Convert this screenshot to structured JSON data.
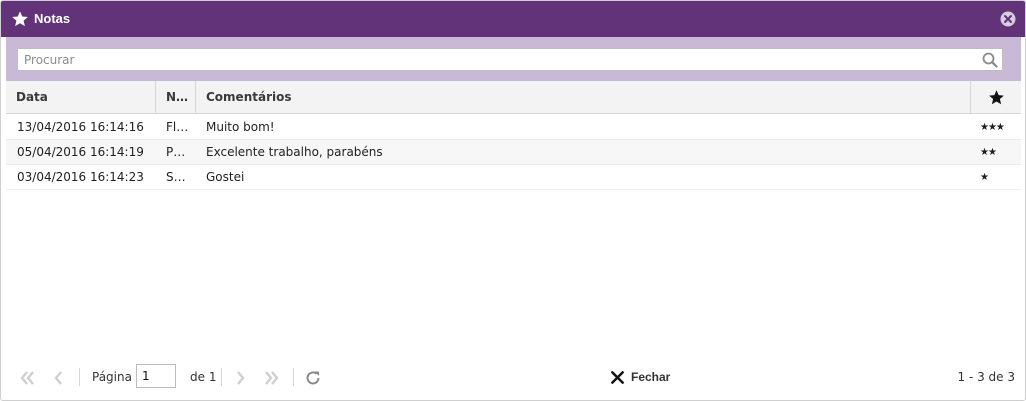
{
  "window": {
    "title": "Notas"
  },
  "search": {
    "placeholder": "Procurar"
  },
  "table": {
    "columns": [
      "Data",
      "N…",
      "Comentários"
    ],
    "rows": [
      {
        "date": "13/04/2016 16:14:16",
        "name": "Fl…",
        "comment": "Muito bom!",
        "stars": "★★★"
      },
      {
        "date": "05/04/2016 16:14:19",
        "name": "P…",
        "comment": "Excelente trabalho, parabéns",
        "stars": "★★"
      },
      {
        "date": "03/04/2016 16:14:23",
        "name": "Su…",
        "comment": "Gostei",
        "stars": "★"
      }
    ]
  },
  "pager": {
    "page_label": "Página",
    "page_value": "1",
    "of_label": "de 1",
    "close_label": "Fechar",
    "count_label": "1 - 3 de 3"
  },
  "colors": {
    "titlebar": "#633379",
    "searchbar": "#c9b8d6",
    "header": "#f3f3f3"
  },
  "icons": {
    "title": "star-icon",
    "close": "close-icon",
    "search": "search-icon",
    "first": "first-page-icon",
    "prev": "prev-page-icon",
    "next": "next-page-icon",
    "last": "last-page-icon",
    "refresh": "refresh-icon",
    "fechar": "x-icon",
    "rating_header": "star-icon"
  }
}
